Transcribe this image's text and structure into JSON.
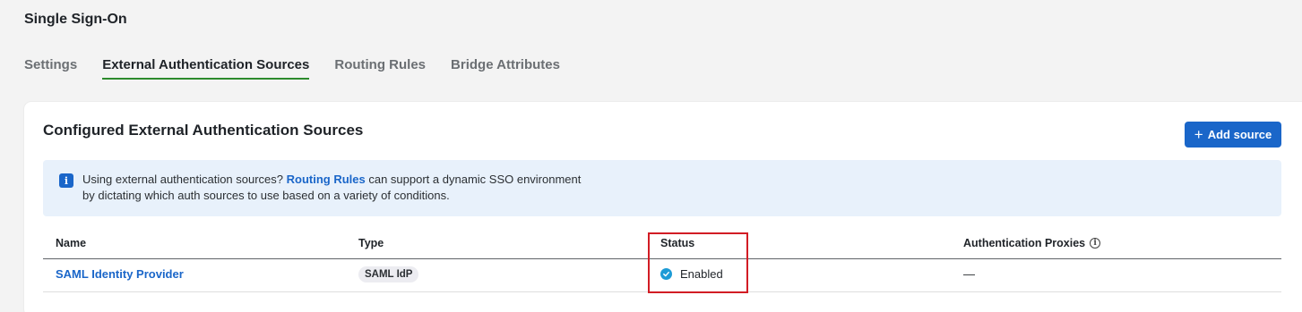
{
  "page": {
    "title": "Single Sign-On"
  },
  "tabs": [
    {
      "label": "Settings",
      "active": false
    },
    {
      "label": "External Authentication Sources",
      "active": true
    },
    {
      "label": "Routing Rules",
      "active": false
    },
    {
      "label": "Bridge Attributes",
      "active": false
    }
  ],
  "card": {
    "title": "Configured External Authentication Sources",
    "add_button": {
      "icon": "plus-icon",
      "label": "Add source"
    }
  },
  "banner": {
    "icon": "info-icon",
    "text_before": "Using external authentication sources? ",
    "link": "Routing Rules",
    "text_after": " can support a dynamic SSO environment by dictating which auth sources to use based on a variety of conditions."
  },
  "table": {
    "columns": [
      "Name",
      "Type",
      "Status",
      "Authentication Proxies"
    ],
    "rows": [
      {
        "name": "SAML Identity Provider",
        "type": "SAML IdP",
        "status": "Enabled",
        "proxies": "—"
      }
    ]
  },
  "colors": {
    "accent": "#1a66c9",
    "active_tab_underline": "#2c8a2c",
    "status_enabled": "#1d9bd6",
    "highlight": "#d21c24"
  }
}
